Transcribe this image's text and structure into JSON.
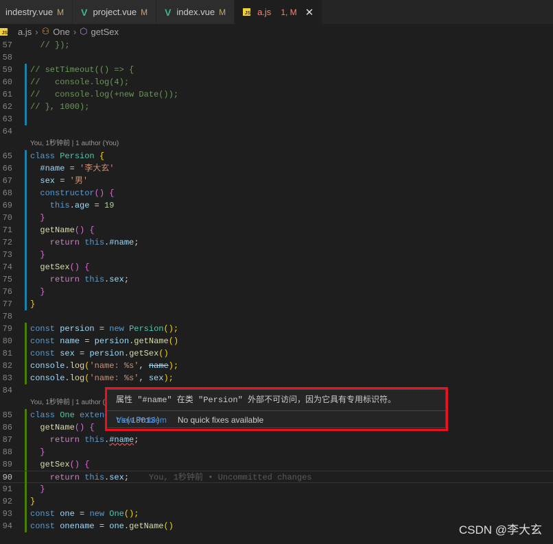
{
  "tabs": [
    {
      "label": "indestry.vue",
      "status": "M",
      "icon": "vue-icon"
    },
    {
      "label": "project.vue",
      "status": "M",
      "icon": "vue-icon"
    },
    {
      "label": "index.vue",
      "status": "M",
      "icon": "vue-icon"
    },
    {
      "label": "a.js",
      "status": "1, M",
      "icon": "js-icon",
      "active": true
    }
  ],
  "breadcrumb": [
    "a.js",
    "One",
    "getSex"
  ],
  "js_badge": "JS",
  "code": [
    {
      "n": "57",
      "tok": [
        [
          "  // });",
          "c"
        ]
      ]
    },
    {
      "n": "58",
      "tok": []
    },
    {
      "n": "59",
      "bar": "#1b81a8",
      "tok": [
        [
          "// setTimeout(() => {",
          "c"
        ]
      ]
    },
    {
      "n": "60",
      "bar": "#1b81a8",
      "tok": [
        [
          "//   console.log(4);",
          "c"
        ]
      ]
    },
    {
      "n": "61",
      "bar": "#1b81a8",
      "tok": [
        [
          "//   console.log(+new Date());",
          "c"
        ]
      ]
    },
    {
      "n": "62",
      "bar": "#1b81a8",
      "tok": [
        [
          "// }, 1000);",
          "c"
        ]
      ]
    },
    {
      "n": "63",
      "bar": "#1b81a8",
      "tok": []
    },
    {
      "n": "64",
      "tok": []
    },
    {
      "lens": "You, 1秒钟前 | 1 author (You)"
    },
    {
      "n": "65",
      "bar": "#1b81a8",
      "tok": [
        [
          "class ",
          "k"
        ],
        [
          "Persion ",
          "t"
        ],
        [
          "{",
          "y"
        ]
      ]
    },
    {
      "n": "66",
      "bar": "#1b81a8",
      "tok": [
        [
          "  #name",
          "p"
        ],
        [
          " = ",
          "w"
        ],
        [
          "'李大玄'",
          "s"
        ]
      ]
    },
    {
      "n": "67",
      "bar": "#1b81a8",
      "tok": [
        [
          "  sex",
          "p"
        ],
        [
          " = ",
          "w"
        ],
        [
          "'男'",
          "s"
        ]
      ]
    },
    {
      "n": "68",
      "bar": "#1b81a8",
      "tok": [
        [
          "  constructor",
          "k"
        ],
        [
          "() ",
          "m2"
        ],
        [
          "{",
          "m2"
        ]
      ]
    },
    {
      "n": "69",
      "bar": "#1b81a8",
      "tok": [
        [
          "    this",
          "k"
        ],
        [
          ".",
          "w"
        ],
        [
          "age",
          "p"
        ],
        [
          " = ",
          "w"
        ],
        [
          "19",
          "n"
        ]
      ]
    },
    {
      "n": "70",
      "bar": "#1b81a8",
      "tok": [
        [
          "  }",
          "m2"
        ]
      ]
    },
    {
      "n": "71",
      "bar": "#1b81a8",
      "tok": [
        [
          "  getName",
          "f"
        ],
        [
          "() {",
          "m2"
        ]
      ]
    },
    {
      "n": "72",
      "bar": "#1b81a8",
      "tok": [
        [
          "    return ",
          "r"
        ],
        [
          "this",
          "k"
        ],
        [
          ".",
          "w"
        ],
        [
          "#name",
          "p"
        ],
        [
          ";",
          "w"
        ]
      ]
    },
    {
      "n": "73",
      "bar": "#1b81a8",
      "tok": [
        [
          "  }",
          "m2"
        ]
      ]
    },
    {
      "n": "74",
      "bar": "#1b81a8",
      "tok": [
        [
          "  getSex",
          "f"
        ],
        [
          "() {",
          "m2"
        ]
      ]
    },
    {
      "n": "75",
      "bar": "#1b81a8",
      "tok": [
        [
          "    return ",
          "r"
        ],
        [
          "this",
          "k"
        ],
        [
          ".",
          "w"
        ],
        [
          "sex",
          "p"
        ],
        [
          ";",
          "w"
        ]
      ]
    },
    {
      "n": "76",
      "bar": "#1b81a8",
      "tok": [
        [
          "  }",
          "m2"
        ]
      ]
    },
    {
      "n": "77",
      "bar": "#1b81a8",
      "tok": [
        [
          "}",
          "y"
        ]
      ]
    },
    {
      "n": "78",
      "tok": []
    },
    {
      "n": "79",
      "bar": "#487e02",
      "tok": [
        [
          "const ",
          "k"
        ],
        [
          "persion",
          "p"
        ],
        [
          " = ",
          "w"
        ],
        [
          "new ",
          "k"
        ],
        [
          "Persion",
          "t"
        ],
        [
          "();",
          "y"
        ]
      ]
    },
    {
      "n": "80",
      "bar": "#487e02",
      "tok": [
        [
          "const ",
          "k"
        ],
        [
          "name",
          "p"
        ],
        [
          " = ",
          "w"
        ],
        [
          "persion",
          "p"
        ],
        [
          ".",
          "w"
        ],
        [
          "getName",
          "f"
        ],
        [
          "()",
          "y"
        ]
      ]
    },
    {
      "n": "81",
      "bar": "#487e02",
      "tok": [
        [
          "const ",
          "k"
        ],
        [
          "sex",
          "p"
        ],
        [
          " = ",
          "w"
        ],
        [
          "persion",
          "p"
        ],
        [
          ".",
          "w"
        ],
        [
          "getSex",
          "f"
        ],
        [
          "()",
          "y"
        ]
      ]
    },
    {
      "n": "82",
      "bar": "#487e02",
      "tok": [
        [
          "console",
          "p"
        ],
        [
          ".",
          "w"
        ],
        [
          "log",
          "f"
        ],
        [
          "(",
          "y"
        ],
        [
          "'name: %s'",
          "s"
        ],
        [
          ", ",
          "w"
        ],
        [
          "name",
          "x"
        ],
        [
          ");",
          "y"
        ]
      ]
    },
    {
      "n": "83",
      "bar": "#487e02",
      "tok": [
        [
          "console",
          "p"
        ],
        [
          ".",
          "w"
        ],
        [
          "log",
          "f"
        ],
        [
          "(",
          "y"
        ],
        [
          "'name: %s'",
          "s"
        ],
        [
          ", ",
          "w"
        ],
        [
          "sex",
          "p"
        ],
        [
          ");",
          "y"
        ]
      ]
    },
    {
      "n": "84",
      "tok": []
    },
    {
      "lens": "You, 1秒钟前 | 1 author (You)"
    },
    {
      "n": "85",
      "bar": "#487e02",
      "tok": [
        [
          "class ",
          "k"
        ],
        [
          "One ",
          "t"
        ],
        [
          "extends ",
          "k"
        ],
        [
          "Persion ",
          "t"
        ],
        [
          "{",
          "y"
        ]
      ]
    },
    {
      "n": "86",
      "bar": "#487e02",
      "tok": [
        [
          "  getName",
          "f"
        ],
        [
          "() {",
          "m2"
        ]
      ]
    },
    {
      "n": "87",
      "bar": "#487e02",
      "tok": [
        [
          "    return ",
          "r"
        ],
        [
          "this",
          "k"
        ],
        [
          ".",
          "w"
        ],
        [
          "#name",
          "e"
        ],
        [
          ";",
          "w"
        ]
      ]
    },
    {
      "n": "88",
      "bar": "#487e02",
      "tok": [
        [
          "  }",
          "m2"
        ]
      ]
    },
    {
      "n": "89",
      "bar": "#487e02",
      "tok": [
        [
          "  getSex",
          "f"
        ],
        [
          "() {",
          "m2"
        ]
      ]
    },
    {
      "n": "90",
      "bar": "#487e02",
      "cur": true,
      "tok": [
        [
          "    return ",
          "r"
        ],
        [
          "this",
          "k"
        ],
        [
          ".",
          "w"
        ],
        [
          "sex",
          "p"
        ],
        [
          ";",
          "w"
        ],
        [
          "    You, 1秒钟前 • Uncommitted changes",
          "g"
        ]
      ]
    },
    {
      "n": "91",
      "bar": "#487e02",
      "tok": [
        [
          "  }",
          "m2"
        ]
      ]
    },
    {
      "n": "92",
      "bar": "#487e02",
      "tok": [
        [
          "}",
          "y"
        ]
      ]
    },
    {
      "n": "93",
      "bar": "#487e02",
      "tok": [
        [
          "const ",
          "k"
        ],
        [
          "one",
          "p"
        ],
        [
          " = ",
          "w"
        ],
        [
          "new ",
          "k"
        ],
        [
          "One",
          "t"
        ],
        [
          "();",
          "y"
        ]
      ]
    },
    {
      "n": "94",
      "bar": "#487e02",
      "tok": [
        [
          "const ",
          "k"
        ],
        [
          "onename",
          "p"
        ],
        [
          " = ",
          "w"
        ],
        [
          "one",
          "p"
        ],
        [
          ".",
          "w"
        ],
        [
          "getName",
          "f"
        ],
        [
          "()",
          "y"
        ]
      ]
    }
  ],
  "hover": {
    "message": "属性 \"#name\" 在类 \"Persion\" 外部不可访问，因为它具有专用标识符。",
    "code": "ts(18013)",
    "view_problem": "View Problem",
    "no_fixes": "No quick fixes available"
  },
  "watermark": "CSDN @李大玄",
  "colors": {
    "highlight_box": "#f00f1e",
    "link": "#3794ff"
  }
}
